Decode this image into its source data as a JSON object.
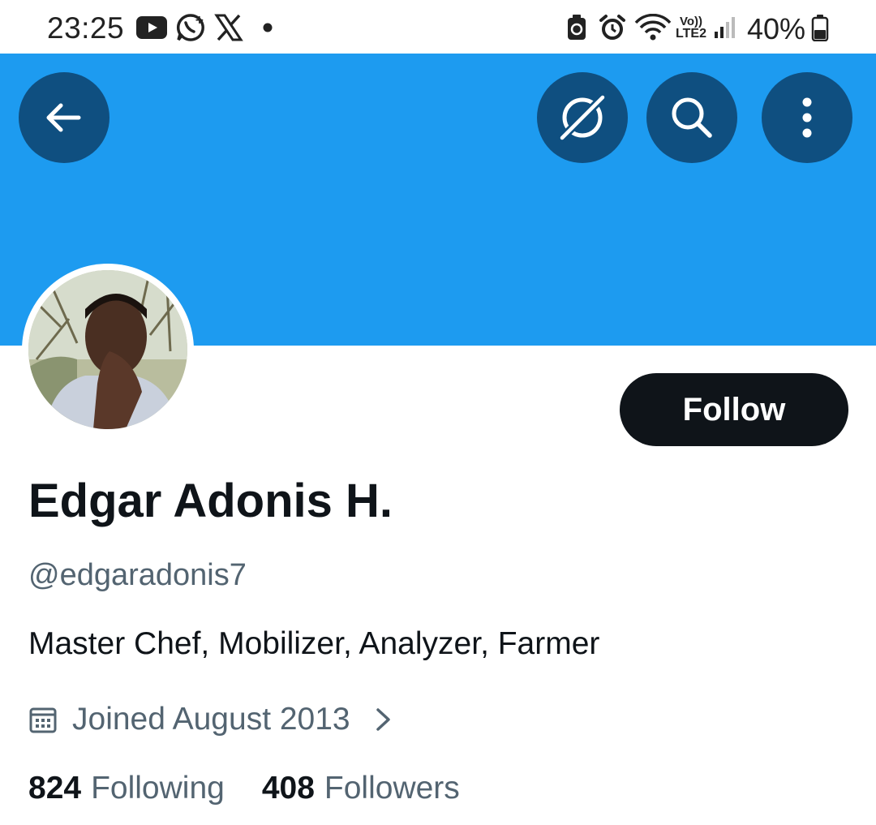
{
  "status_bar": {
    "time": "23:25",
    "battery_percent": "40%",
    "network_label_top": "Vo))",
    "network_label_bottom": "LTE2",
    "notification_icons": [
      "youtube-icon",
      "whatsapp-icon",
      "x-icon",
      "dot-icon"
    ],
    "system_icons": [
      "battery-saver-icon",
      "alarm-icon",
      "wifi-icon",
      "signal-icon",
      "battery-icon"
    ]
  },
  "header": {
    "banner_color": "#1d9bf0",
    "button_color": "#0f4f80",
    "buttons": [
      "back-arrow-icon",
      "grok-icon",
      "search-icon",
      "more-vertical-icon"
    ]
  },
  "profile": {
    "avatar": "profile-photo",
    "follow_label": "Follow",
    "display_name": "Edgar Adonis H.",
    "handle": "@edgaradonis7",
    "bio": "Master Chef, Mobilizer, Analyzer, Farmer",
    "joined": "Joined August 2013",
    "following_count": "824",
    "following_label": "Following",
    "followers_count": "408",
    "followers_label": "Followers"
  }
}
